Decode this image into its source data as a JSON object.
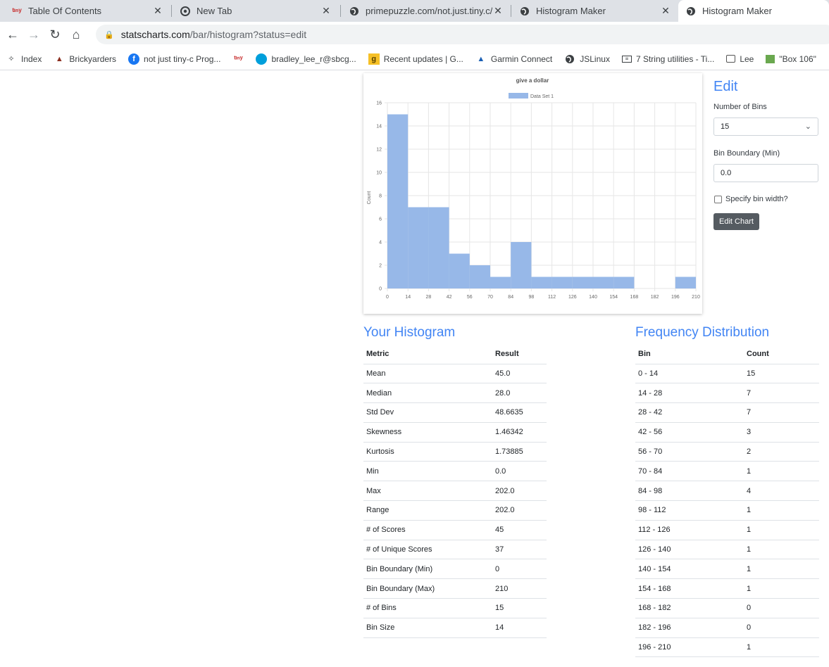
{
  "browser": {
    "tabs": [
      {
        "title": "Table Of Contents",
        "icon": "tiny-c-icon"
      },
      {
        "title": "New Tab",
        "icon": "chrome-icon"
      },
      {
        "title": "primepuzzle.com/not.just.tiny.c/c",
        "icon": "globe-icon"
      },
      {
        "title": "Histogram Maker",
        "icon": "globe-icon"
      },
      {
        "title": "Histogram Maker",
        "icon": "globe-icon",
        "active": true
      }
    ],
    "url_host": "statscharts.com",
    "url_path": "/bar/histogram?status=edit",
    "bookmarks": [
      {
        "label": "Index",
        "icon": "bookmark-folder-icon"
      },
      {
        "label": "Brickyarders",
        "icon": "brick-icon"
      },
      {
        "label": "not just tiny-c Prog...",
        "icon": "facebook-icon"
      },
      {
        "label": "",
        "icon": "tiny-c-icon"
      },
      {
        "label": "bradley_lee_r@sbcg...",
        "icon": "att-icon"
      },
      {
        "label": "Recent updates | G...",
        "icon": "g-icon"
      },
      {
        "label": "Garmin Connect",
        "icon": "garmin-icon"
      },
      {
        "label": "JSLinux",
        "icon": "globe-icon"
      },
      {
        "label": "7 String utilities - Ti...",
        "icon": "doc-icon"
      },
      {
        "label": "Lee",
        "icon": "disk-icon"
      },
      {
        "label": "\"Box 106\"",
        "icon": "box-icon"
      }
    ]
  },
  "edit": {
    "title": "Edit",
    "bins_label": "Number of Bins",
    "bins_value": "15",
    "boundary_label": "Bin Boundary (Min)",
    "boundary_value": "0.0",
    "bin_width_label": "Specify bin width?",
    "bin_width_checked": false,
    "edit_button": "Edit Chart"
  },
  "chart_data": {
    "type": "bar",
    "title": "give a dollar",
    "ylabel": "Count",
    "xlabel": "",
    "legend": "top",
    "series": [
      {
        "name": "Data Set 1",
        "color": "#97b8e8"
      }
    ],
    "x_ticks": [
      0,
      14,
      28,
      42,
      56,
      70,
      84,
      98,
      112,
      126,
      140,
      154,
      168,
      182,
      196,
      210
    ],
    "y_ticks": [
      0,
      2,
      4,
      6,
      8,
      10,
      12,
      14,
      16
    ],
    "ylim": [
      0,
      16
    ],
    "xlim": [
      0,
      210
    ],
    "bin_edges": [
      0,
      14,
      28,
      42,
      56,
      70,
      84,
      98,
      112,
      126,
      140,
      154,
      168,
      182,
      196,
      210
    ],
    "values": [
      15,
      7,
      7,
      3,
      2,
      1,
      4,
      1,
      1,
      1,
      1,
      1,
      0,
      0,
      1
    ],
    "grid": true
  },
  "histogram": {
    "title": "Your Histogram",
    "headers": [
      "Metric",
      "Result"
    ],
    "rows": [
      [
        "Mean",
        "45.0"
      ],
      [
        "Median",
        "28.0"
      ],
      [
        "Std Dev",
        "48.6635"
      ],
      [
        "Skewness",
        "1.46342"
      ],
      [
        "Kurtosis",
        "1.73885"
      ],
      [
        "Min",
        "0.0"
      ],
      [
        "Max",
        "202.0"
      ],
      [
        "Range",
        "202.0"
      ],
      [
        "# of Scores",
        "45"
      ],
      [
        "# of Unique Scores",
        "37"
      ],
      [
        "Bin Boundary (Min)",
        "0"
      ],
      [
        "Bin Boundary (Max)",
        "210"
      ],
      [
        "# of Bins",
        "15"
      ],
      [
        "Bin Size",
        "14"
      ]
    ]
  },
  "frequency": {
    "title": "Frequency Distribution",
    "headers": [
      "Bin",
      "Count"
    ],
    "rows": [
      [
        "0 - 14",
        "15"
      ],
      [
        "14 - 28",
        "7"
      ],
      [
        "28 - 42",
        "7"
      ],
      [
        "42 - 56",
        "3"
      ],
      [
        "56 - 70",
        "2"
      ],
      [
        "70 - 84",
        "1"
      ],
      [
        "84 - 98",
        "4"
      ],
      [
        "98 - 112",
        "1"
      ],
      [
        "112 - 126",
        "1"
      ],
      [
        "126 - 140",
        "1"
      ],
      [
        "140 - 154",
        "1"
      ],
      [
        "154 - 168",
        "1"
      ],
      [
        "168 - 182",
        "0"
      ],
      [
        "182 - 196",
        "0"
      ],
      [
        "196 - 210",
        "1"
      ]
    ]
  }
}
